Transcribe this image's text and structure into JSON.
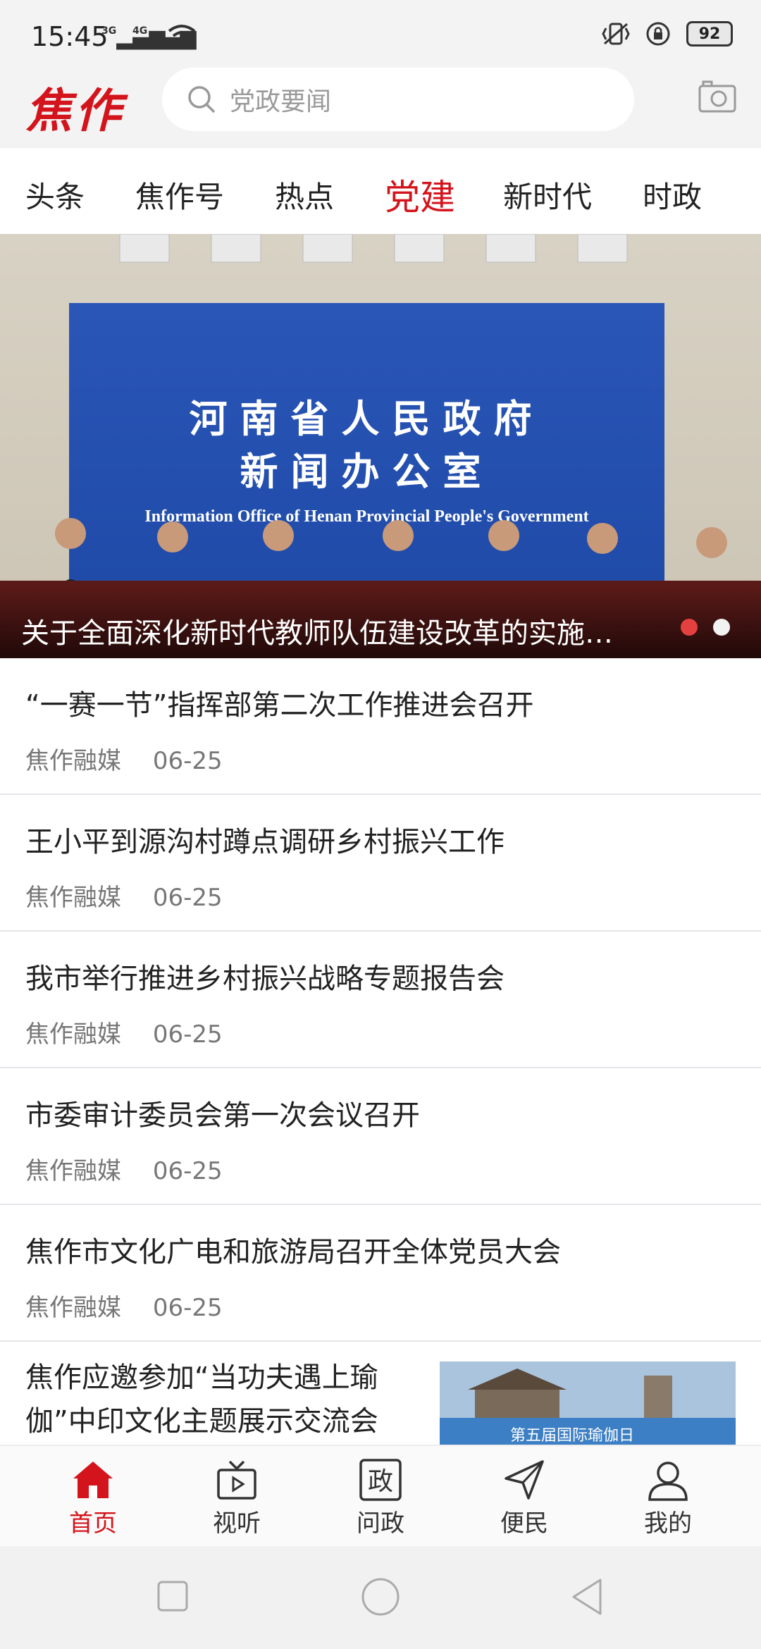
{
  "status_bar": {
    "time": "15:45",
    "signal1": "3G",
    "signal2": "4G",
    "battery": "92"
  },
  "header": {
    "logo_text": "焦作",
    "search_placeholder": "党政要闻",
    "brand_color": "#d4141c"
  },
  "tabs": [
    {
      "label": "头条",
      "active": false
    },
    {
      "label": "焦作号",
      "active": false
    },
    {
      "label": "热点",
      "active": false
    },
    {
      "label": "党建",
      "active": true
    },
    {
      "label": "新时代",
      "active": false
    },
    {
      "label": "时政",
      "active": false
    }
  ],
  "banner": {
    "caption": "关于全面深化新时代教师队伍建设改革的实施…",
    "board_line1": "河南省人民政府",
    "board_line2": "新闻办公室",
    "board_en": "Information Office of Henan Provincial People's Government"
  },
  "articles": [
    {
      "title": "“一赛一节”指挥部第二次工作推进会召开",
      "source": "焦作融媒",
      "date": "06-25"
    },
    {
      "title": "王小平到源沟村蹲点调研乡村振兴工作",
      "source": "焦作融媒",
      "date": "06-25"
    },
    {
      "title": "我市举行推进乡村振兴战略专题报告会",
      "source": "焦作融媒",
      "date": "06-25"
    },
    {
      "title": "市委审计委员会第一次会议召开",
      "source": "焦作融媒",
      "date": "06-25"
    },
    {
      "title": " 焦作市文化广电和旅游局召开全体党员大会",
      "source": "焦作融媒",
      "date": "06-25"
    }
  ],
  "thumb_article": {
    "title_line1": "焦作应邀参加“当功夫遇上瑜",
    "title_line2": "伽”中印文化主题展示交流会",
    "thumb_text": "第五届国际瑜伽日"
  },
  "bottom_nav": [
    {
      "label": "首页",
      "icon": "home-icon",
      "active": true
    },
    {
      "label": "视听",
      "icon": "tv-icon",
      "active": false
    },
    {
      "label": "问政",
      "icon": "zheng-icon",
      "active": false
    },
    {
      "label": "便民",
      "icon": "send-icon",
      "active": false
    },
    {
      "label": "我的",
      "icon": "user-icon",
      "active": false
    }
  ],
  "bottom_nav_zheng_glyph": "政"
}
